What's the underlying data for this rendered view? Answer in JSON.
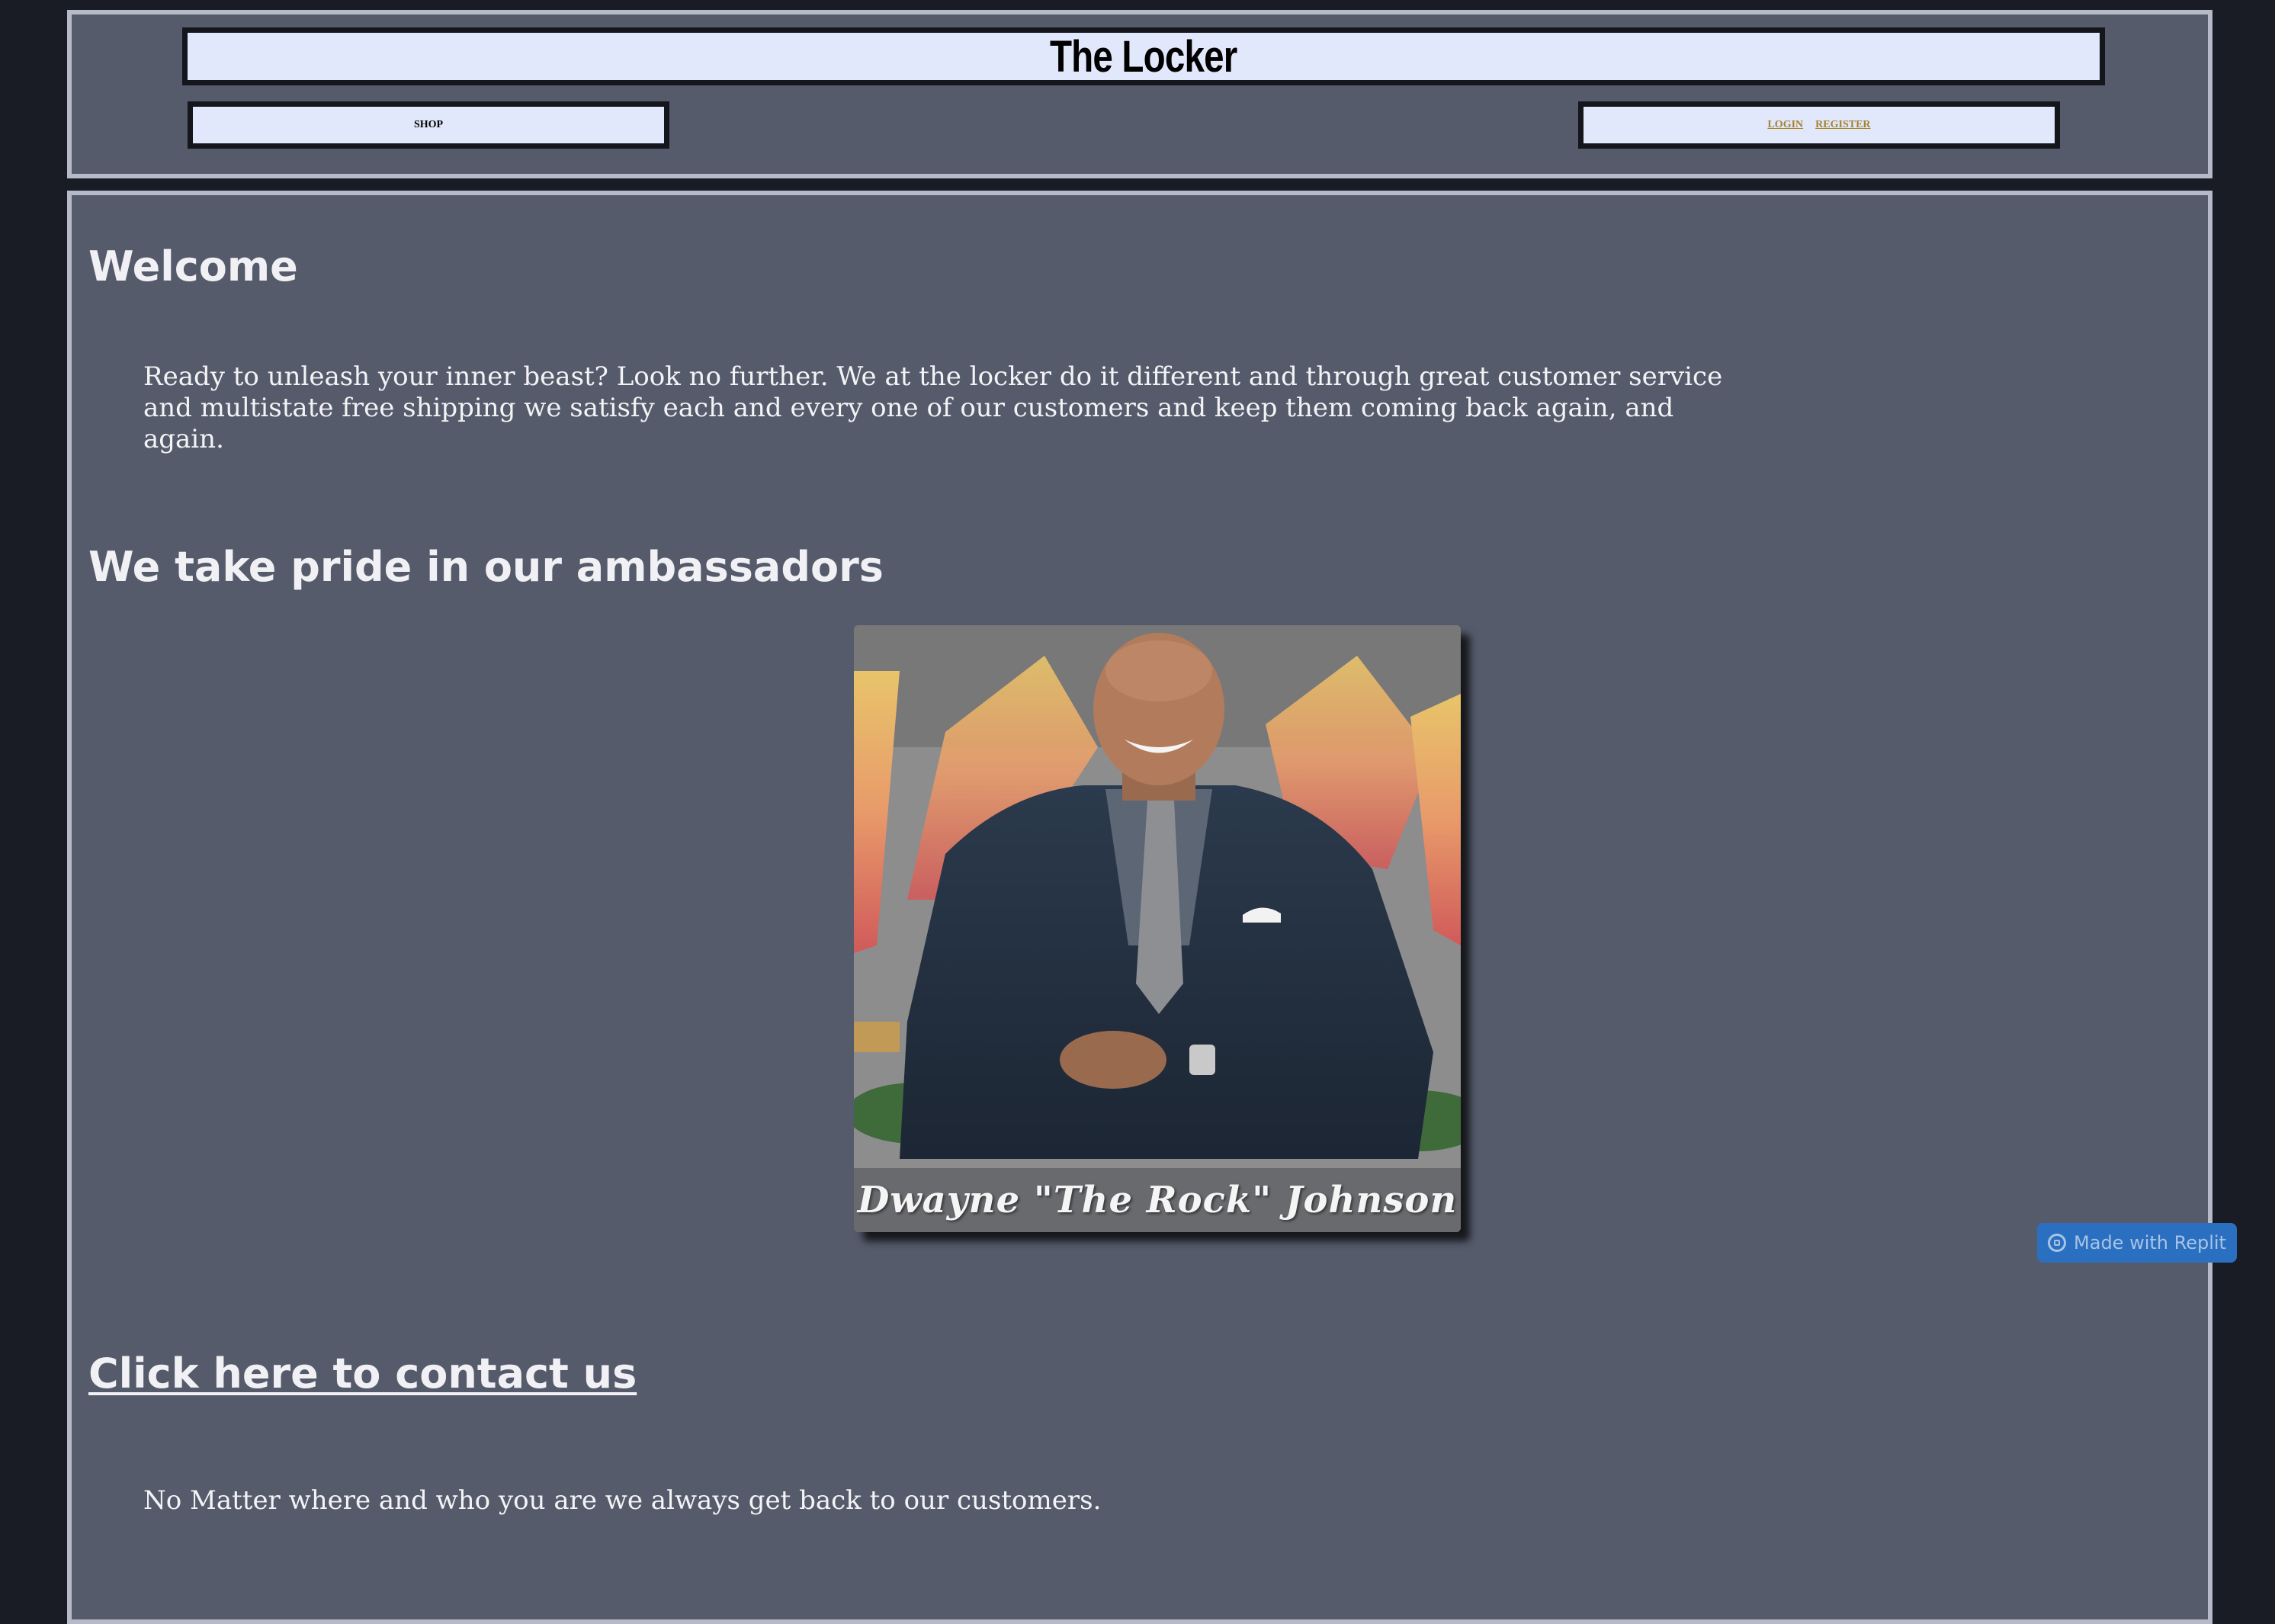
{
  "header": {
    "title": "The Locker",
    "nav": {
      "shop_label": "SHOP",
      "login_label": "LOGIN",
      "register_label": "REGISTER"
    }
  },
  "main": {
    "welcome_heading": "Welcome",
    "welcome_text": "Ready to unleash your inner beast? Look no further. We at the locker do it different and through great customer service and multistate free shipping we satisfy each and every one of our customers and keep them coming back again, and again.",
    "ambassadors_heading": "We take pride in our ambassadors",
    "ambassador_caption": "Dwayne \"The Rock\" Johnson",
    "contact_link": "Click here to contact us",
    "closing_text": "No Matter where and who you are we always get back to our customers."
  },
  "badge": {
    "label": "Made with Replit"
  },
  "colors": {
    "page_bg": "#191c24",
    "panel_bg": "#555b6b",
    "panel_border": "#b6bac8",
    "nav_bg": "#e2e8fb",
    "link_gold": "#a5822c",
    "badge_blue": "#2a6fc0"
  }
}
